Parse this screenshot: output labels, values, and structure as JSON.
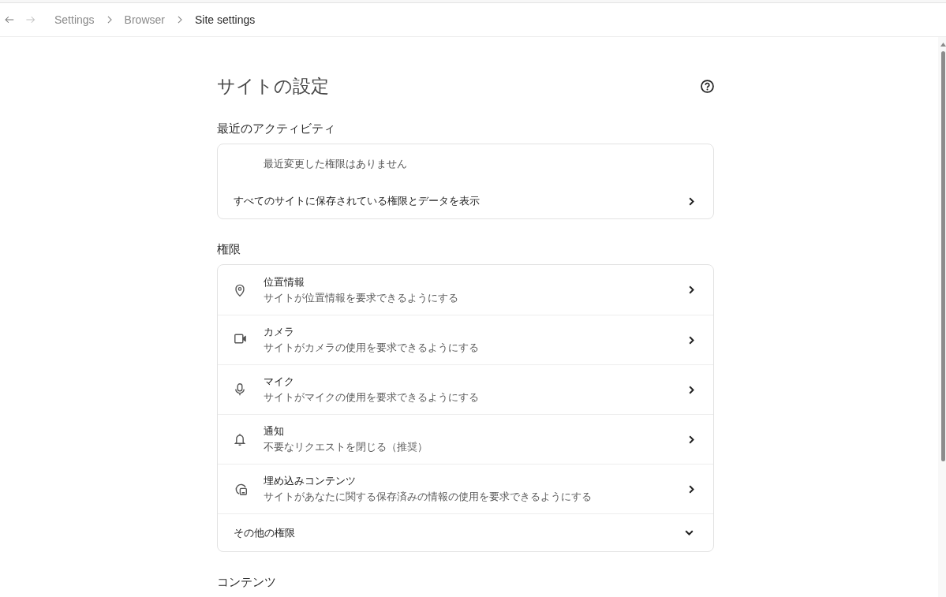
{
  "navigation": {
    "back": {
      "disabled": false
    },
    "forward": {
      "disabled": true
    },
    "breadcrumbs": [
      {
        "label": "Settings",
        "current": false
      },
      {
        "label": "Browser",
        "current": false
      },
      {
        "label": "Site settings",
        "current": true
      }
    ]
  },
  "page": {
    "title": "サイトの設定"
  },
  "sections": [
    {
      "heading": "最近のアクティビティ",
      "rows": [
        {
          "kind": "note",
          "text": "最近変更した権限はありません"
        },
        {
          "kind": "link",
          "label": "すべてのサイトに保存されている権限とデータを表示"
        }
      ]
    },
    {
      "heading": "権限",
      "rows": [
        {
          "kind": "permission",
          "title": "位置情報",
          "subtitle": "サイトが位置情報を要求できるようにする"
        },
        {
          "kind": "permission",
          "title": "カメラ",
          "subtitle": "サイトがカメラの使用を要求できるようにする"
        },
        {
          "kind": "permission",
          "title": "マイク",
          "subtitle": "サイトがマイクの使用を要求できるようにする"
        },
        {
          "kind": "permission",
          "title": "通知",
          "subtitle": "不要なリクエストを閉じる（推奨）"
        },
        {
          "kind": "permission",
          "title": "埋め込みコンテンツ",
          "subtitle": "サイトがあなたに関する保存済みの情報の使用を要求できるようにする"
        },
        {
          "kind": "expander",
          "label": "その他の権限",
          "expanded": false
        }
      ]
    },
    {
      "heading": "コンテンツ"
    }
  ]
}
